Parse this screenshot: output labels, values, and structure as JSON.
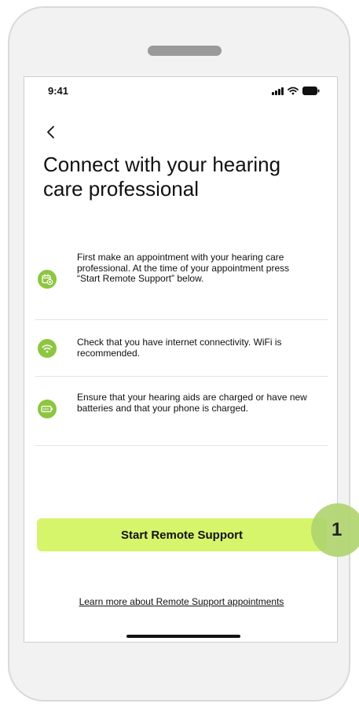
{
  "status_bar": {
    "time": "9:41",
    "icons": [
      "signal-icon",
      "wifi-icon",
      "battery-icon"
    ]
  },
  "header": {
    "back_icon": "chevron-left-icon",
    "title": "Connect with your hearing care professional"
  },
  "info_items": [
    {
      "icon": "calendar-add-icon",
      "text": "First make an appointment with your hearing care professional. At the time of your appointment press “Start Remote Support” below."
    },
    {
      "icon": "wifi-icon",
      "text": "Check that you have internet connectivity. WiFi is recommended."
    },
    {
      "icon": "battery-icon",
      "text": "Ensure that your hearing aids are charged or have new batteries and that your phone is charged."
    }
  ],
  "actions": {
    "start_label": "Start Remote Support",
    "learn_more_label": "Learn more about Remote Support appointments"
  },
  "callout": {
    "number": "1"
  },
  "colors": {
    "accent": "#d6f56a",
    "icon_green": "#8cc63f",
    "callout": "#b0d56f"
  }
}
